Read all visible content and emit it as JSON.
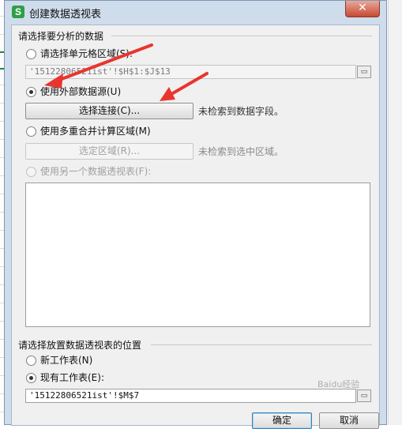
{
  "dialog": {
    "title": "创建数据透视表",
    "app_icon_letter": "S",
    "close_label": "✕"
  },
  "source_group": {
    "title": "请选择要分析的数据",
    "option_range": {
      "label": "请选择单元格区域(S):",
      "checked": false
    },
    "range_value": "'15122806521ist'!$H$1:$J$13",
    "option_external": {
      "label": "使用外部数据源(U)",
      "checked": true
    },
    "choose_connection_button": "选择连接(C)...",
    "no_fields_hint": "未检索到数据字段。",
    "option_multi": {
      "label": "使用多重合并计算区域(M)",
      "checked": false
    },
    "select_region_button": "选定区域(R)...",
    "no_region_hint": "未检索到选中区域。",
    "option_other_pivot": {
      "label": "使用另一个数据透视表(F):",
      "checked": false,
      "disabled": true
    }
  },
  "location_group": {
    "title": "请选择放置数据透视表的位置",
    "option_new_sheet": {
      "label": "新工作表(N)",
      "checked": false
    },
    "option_existing_sheet": {
      "label": "现有工作表(E):",
      "checked": true
    },
    "location_value": "'15122806521ist'!$M$7"
  },
  "footer": {
    "ok_label": "确定",
    "cancel_label": "取消"
  },
  "watermark": "Baidu经验",
  "colors": {
    "dialog_frame": "#cfdcec",
    "content_bg": "#f0f0f0",
    "annotation_arrow": "#e8352e",
    "close_button": "#c64a33",
    "app_icon": "#2f9e48"
  }
}
